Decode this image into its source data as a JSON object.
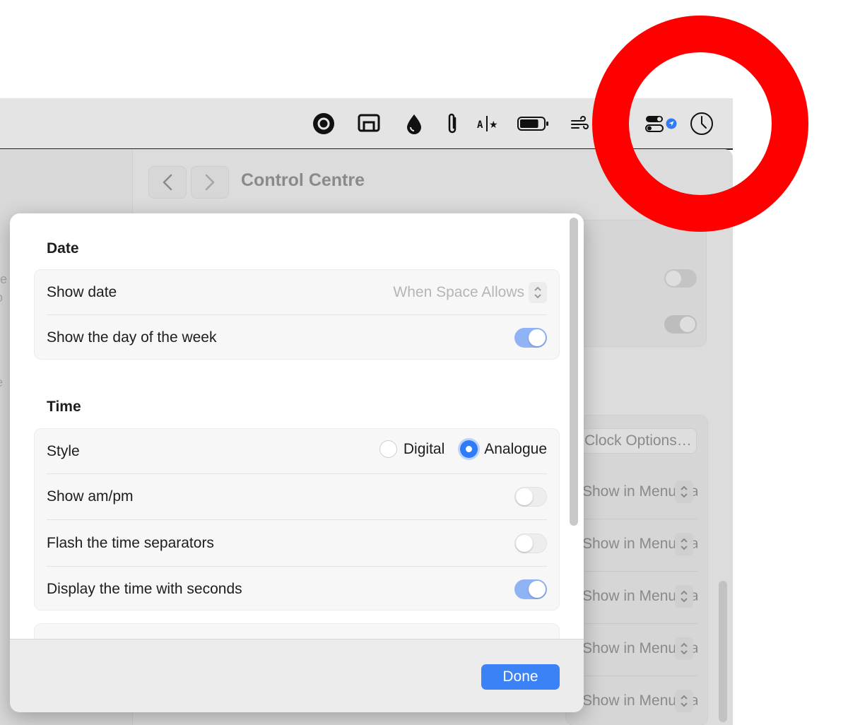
{
  "menu_bar": {
    "icons": [
      "screen-record-icon",
      "display-mirroring-icon",
      "ink-drop-icon",
      "paperclip-icon",
      "text-translate-icon",
      "battery-icon",
      "wind-icon",
      "control-centre-icon",
      "location-indicator-icon",
      "clock-icon"
    ],
    "battery_level": 0.8
  },
  "background_window": {
    "title": "Control Centre",
    "options_button": "Clock Options…",
    "menu_bar_rows": [
      "Show in Menu Bar",
      "Show in Menu Bar",
      "Show in Menu Bar",
      "Show in Menu Bar",
      "Show in Menu Bar"
    ],
    "sidebar_fragments": [
      "re",
      "o",
      "e"
    ]
  },
  "sheet": {
    "date": {
      "title": "Date",
      "show_date_label": "Show date",
      "show_date_value": "When Space Allows",
      "show_day_label": "Show the day of the week",
      "show_day_enabled": true
    },
    "time": {
      "title": "Time",
      "style_label": "Style",
      "style_options": [
        "Digital",
        "Analogue"
      ],
      "style_selected": "Analogue",
      "ampm_label": "Show am/pm",
      "ampm_enabled": false,
      "flash_label": "Flash the time separators",
      "flash_enabled": false,
      "seconds_label": "Display the time with seconds",
      "seconds_enabled": true
    },
    "done_label": "Done"
  },
  "colors": {
    "accent": "#3b82f6",
    "annotation_ring": "#ff0000",
    "toggle_on": "#8fb3f5"
  }
}
